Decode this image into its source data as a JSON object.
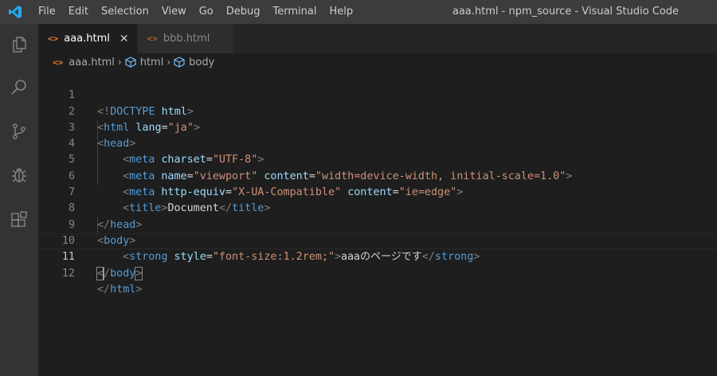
{
  "window": {
    "title": "aaa.html - npm_source - Visual Studio Code"
  },
  "menu": [
    "File",
    "Edit",
    "Selection",
    "View",
    "Go",
    "Debug",
    "Terminal",
    "Help"
  ],
  "activitybar": {
    "icons": [
      "explorer-icon",
      "search-icon",
      "source-control-icon",
      "debug-icon",
      "extensions-icon"
    ]
  },
  "tabs": [
    {
      "label": "aaa.html",
      "icon": "<>",
      "active": true,
      "close": "✕"
    },
    {
      "label": "bbb.html",
      "icon": "<>",
      "active": false
    }
  ],
  "breadcrumb": {
    "file": "aaa.html",
    "items": [
      "html",
      "body"
    ],
    "separator": "›",
    "file_icon": "<>"
  },
  "editor": {
    "line_numbers": [
      "1",
      "2",
      "3",
      "4",
      "5",
      "6",
      "7",
      "8",
      "9",
      "10",
      "11",
      "12"
    ],
    "active_line": 11,
    "tokens": {
      "l1": {
        "open": "<!",
        "tag": "DOCTYPE",
        "sp": " ",
        "attr": "html",
        "close": ">"
      },
      "l2": {
        "open": "<",
        "tag": "html",
        "sp": " ",
        "attr": "lang",
        "eq": "=",
        "str": "\"ja\"",
        "close": ">"
      },
      "l3": {
        "open": "<",
        "tag": "head",
        "close": ">"
      },
      "l4": {
        "open": "<",
        "tag": "meta",
        "sp": " ",
        "attr": "charset",
        "eq": "=",
        "str": "\"UTF-8\"",
        "close": ">"
      },
      "l5": {
        "open": "<",
        "tag": "meta",
        "sp": " ",
        "attr1": "name",
        "eq1": "=",
        "str1": "\"viewport\"",
        "sp2": " ",
        "attr2": "content",
        "eq2": "=",
        "str2": "\"width=device-width, initial-scale=1.0\"",
        "close": ">"
      },
      "l6": {
        "open": "<",
        "tag": "meta",
        "sp": " ",
        "attr1": "http-equiv",
        "eq1": "=",
        "str1": "\"X-UA-Compatible\"",
        "sp2": " ",
        "attr2": "content",
        "eq2": "=",
        "str2": "\"ie=edge\"",
        "close": ">"
      },
      "l7": {
        "open": "<",
        "tag": "title",
        "close": ">",
        "text": "Document",
        "open2": "</",
        "tag2": "title",
        "close2": ">"
      },
      "l8": {
        "open": "</",
        "tag": "head",
        "close": ">"
      },
      "l9": {
        "open": "<",
        "tag": "body",
        "close": ">"
      },
      "l10": {
        "open": "<",
        "tag": "strong",
        "sp": " ",
        "attr": "style",
        "eq": "=",
        "str": "\"font-size:1.2rem;\"",
        "close": ">",
        "text": "aaaのページです",
        "open2": "</",
        "tag2": "strong",
        "close2": ">"
      },
      "l11": {
        "open": "<",
        "slash": "/",
        "tag": "body",
        "close": ">"
      },
      "l12": {
        "open": "</",
        "tag": "html",
        "close": ">"
      }
    }
  },
  "colors": {
    "titlebar": "#3c3c3c",
    "activitybar": "#333333",
    "editor_bg": "#1e1e1e",
    "tag": "#569cd6",
    "attribute": "#9cdcfe",
    "string": "#ce9178",
    "bracket": "#808080",
    "html_icon": "#e37933",
    "vscode_logo": "#23a9f2"
  }
}
